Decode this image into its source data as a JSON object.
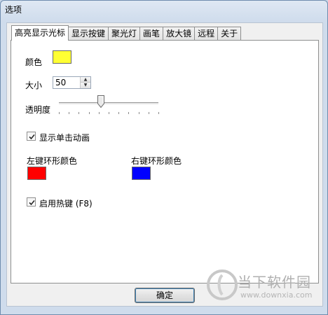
{
  "window": {
    "title": "选项"
  },
  "tabs": [
    {
      "label": "高亮显示光标",
      "active": true
    },
    {
      "label": "显示按键",
      "active": false
    },
    {
      "label": "聚光灯",
      "active": false
    },
    {
      "label": "画笔",
      "active": false
    },
    {
      "label": "放大镜",
      "active": false
    },
    {
      "label": "远程",
      "active": false
    },
    {
      "label": "关于",
      "active": false
    }
  ],
  "panel": {
    "color_label": "颜色",
    "color_value": "#ffff33",
    "size_label": "大小",
    "size_value": "50",
    "opacity_label": "透明度",
    "opacity_level": 0.42,
    "show_click_animation_label": "显示单击动画",
    "show_click_animation_checked": true,
    "left_ring_color_label": "左键环形颜色",
    "left_ring_color": "#ff0000",
    "right_ring_color_label": "右键环形颜色",
    "right_ring_color": "#0000ff",
    "enable_hotkey_label": "启用热键 (F8)",
    "enable_hotkey_checked": true
  },
  "footer": {
    "ok_label": "确定"
  },
  "watermark": {
    "text": "当下软件园",
    "url": "www.downxia.com"
  }
}
